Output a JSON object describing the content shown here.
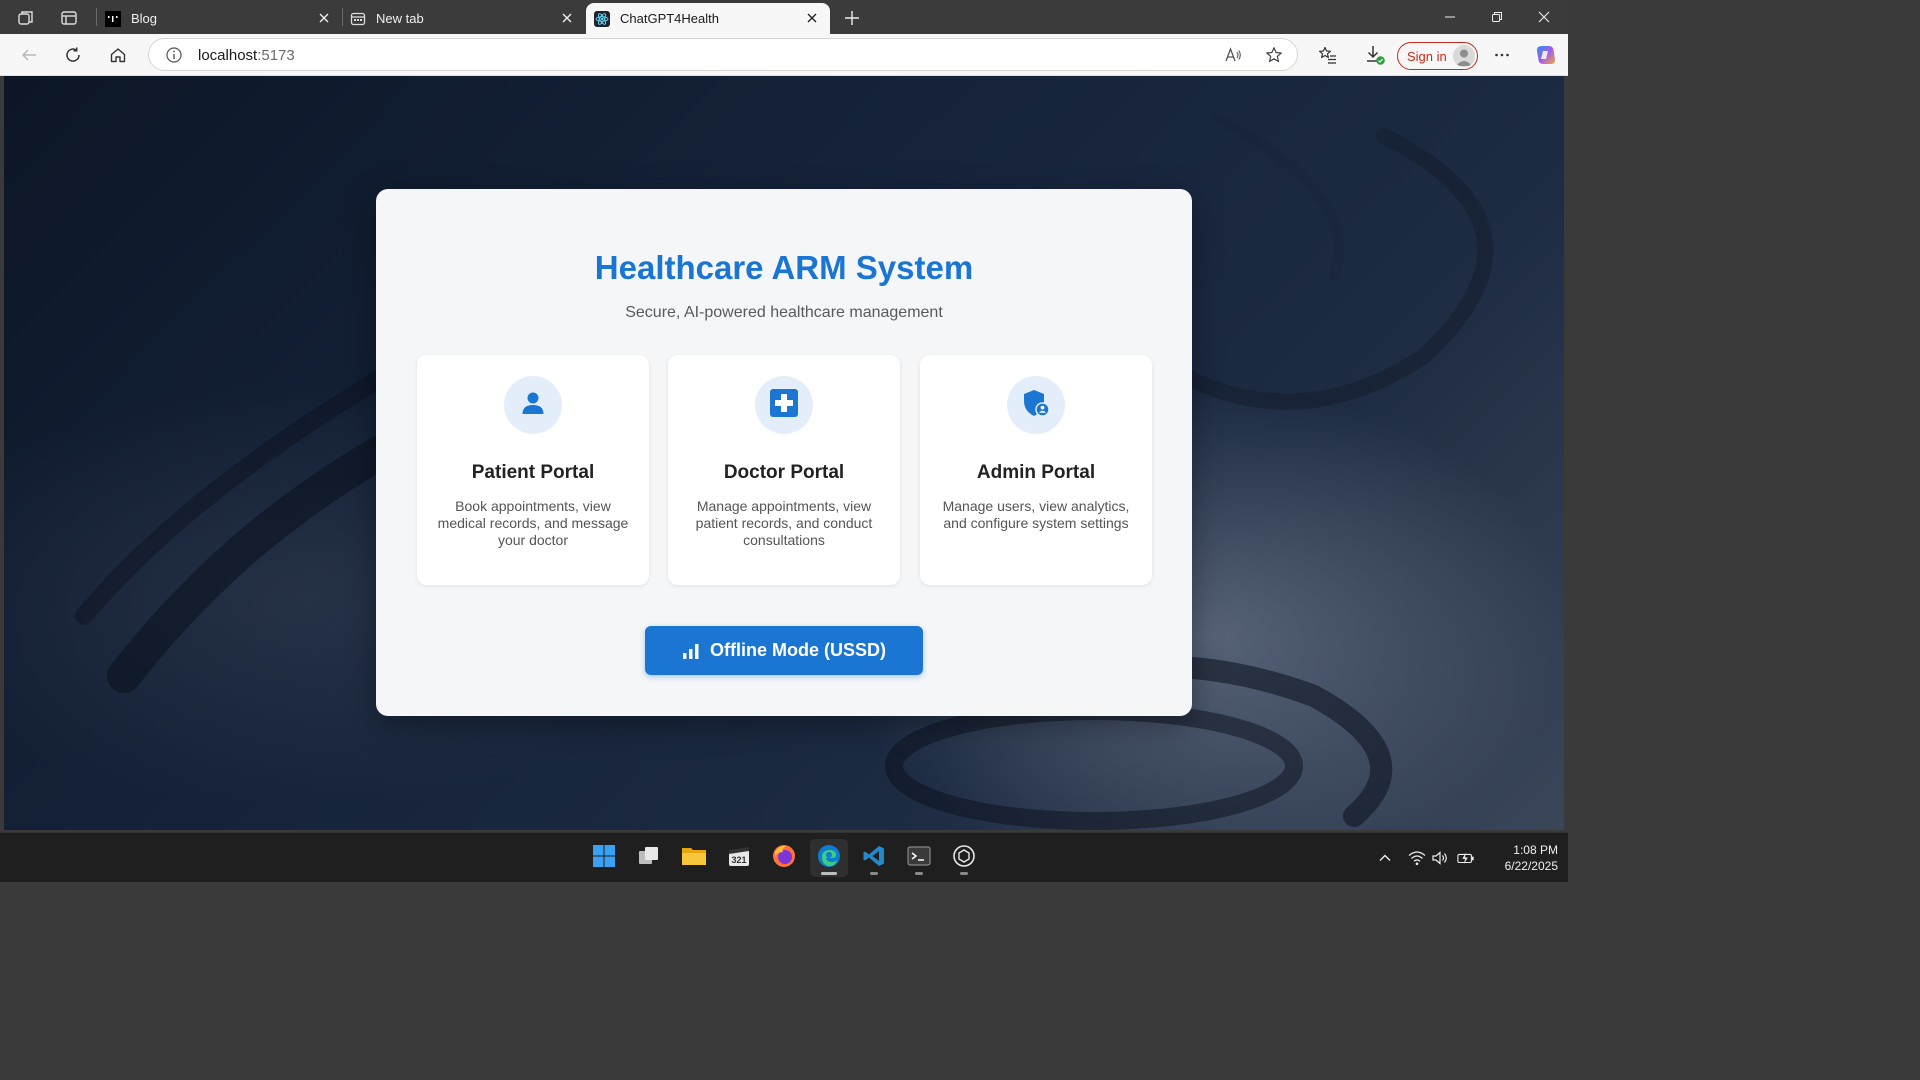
{
  "browser": {
    "tabs": [
      {
        "title": "Blog",
        "favicon": "blog-logo-icon",
        "active": false
      },
      {
        "title": "New tab",
        "favicon": "new-tab-icon",
        "active": false
      },
      {
        "title": "ChatGPT4Health",
        "favicon": "react-logo-icon",
        "active": true
      }
    ],
    "address": {
      "host": "localhost",
      "port": ":5173"
    },
    "sign_in_label": "Sign in"
  },
  "page": {
    "title": "Healthcare ARM System",
    "subtitle": "Secure, AI-powered healthcare management",
    "portals": [
      {
        "title": "Patient Portal",
        "icon": "user-icon",
        "description": "Book appointments, view medical records, and message your doctor"
      },
      {
        "title": "Doctor Portal",
        "icon": "medical-cross-icon",
        "description": "Manage appointments, view patient records, and conduct consultations"
      },
      {
        "title": "Admin Portal",
        "icon": "shield-user-icon",
        "description": "Manage users, view analytics, and configure system settings"
      }
    ],
    "offline_button": {
      "label": "Offline Mode (USSD)",
      "icon": "signal-bars-icon"
    },
    "accent_color": "#1a76d2"
  },
  "taskbar": {
    "apps": [
      "start",
      "task-view",
      "file-explorer",
      "calendar",
      "firefox",
      "edge",
      "vscode",
      "terminal",
      "chatgpt"
    ],
    "clock": {
      "time": "1:08 PM",
      "date": "6/22/2025"
    }
  }
}
